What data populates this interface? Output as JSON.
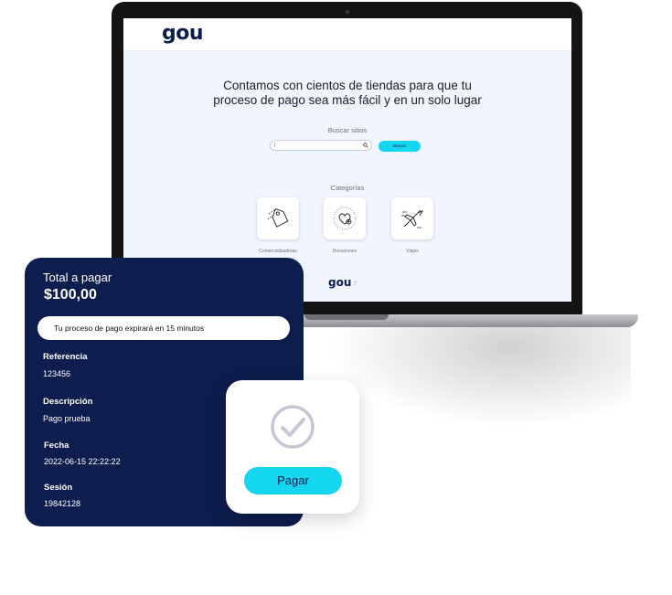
{
  "site": {
    "logo": "gou",
    "hero_title_line1": "Contamos con cientos de tiendas para que tu",
    "hero_title_line2": "proceso de pago sea más fácil y en un solo lugar",
    "search_label": "Buscar sitios",
    "search_button": "Buscar",
    "categories_label": "Categorías",
    "categories": [
      {
        "label": "Comercializadoras",
        "icon": "price-tag-icon"
      },
      {
        "label": "Donaciones",
        "icon": "heart-donation-icon"
      },
      {
        "label": "Viajes",
        "icon": "airplane-icon"
      }
    ],
    "footer_logo": "gou"
  },
  "payment": {
    "total_label": "Total a pagar",
    "total_amount": "$100,00",
    "expiry_message": "Tu proceso de pago expirará en 15 minutos",
    "reference_label": "Referencia",
    "reference_value": "123456",
    "description_label": "Descripción",
    "description_value": "Pago prueba",
    "date_label": "Fecha",
    "date_value": "2022-06-15 22:22:22",
    "session_label": "Sesión",
    "session_value": "19842128"
  },
  "pay_card": {
    "button_label": "Pagar",
    "icon": "check-circle-icon"
  },
  "colors": {
    "navy": "#0d1d4d",
    "accent": "#15d6f0",
    "screen_bg": "#f1f5fd"
  }
}
